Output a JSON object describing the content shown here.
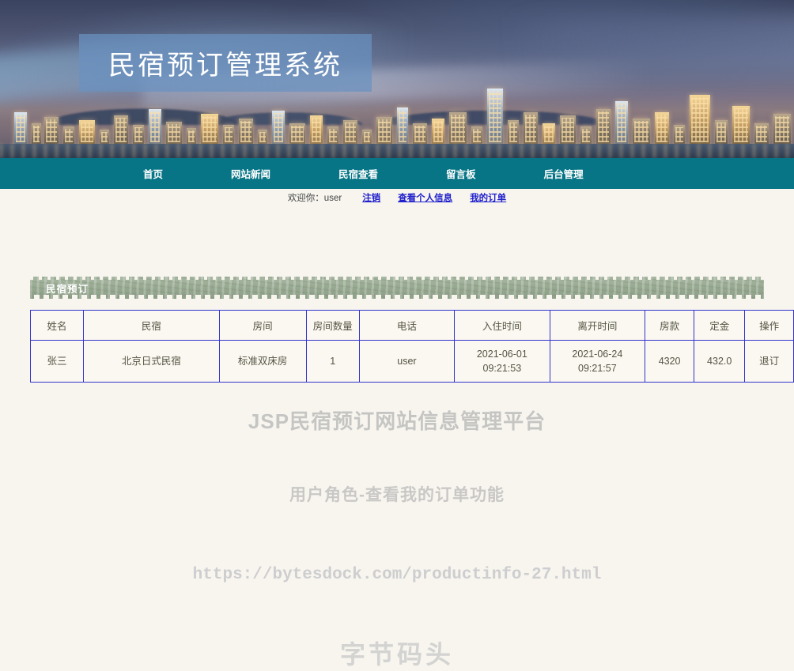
{
  "banner": {
    "title": "民宿预订管理系统",
    "image_alt": "city-night-skyline"
  },
  "nav": {
    "items": [
      {
        "label": "首页",
        "name": "nav-home"
      },
      {
        "label": "网站新闻",
        "name": "nav-news"
      },
      {
        "label": "民宿查看",
        "name": "nav-homestay"
      },
      {
        "label": "留言板",
        "name": "nav-message-board"
      },
      {
        "label": "后台管理",
        "name": "nav-admin"
      }
    ]
  },
  "userbar": {
    "welcome": "欢迎你：user",
    "logout": "注销",
    "profile": "查看个人信息",
    "orders": "我的订单"
  },
  "section": {
    "title": "民宿预订"
  },
  "table": {
    "headers": [
      "姓名",
      "民宿",
      "房间",
      "房间数量",
      "电话",
      "入住时间",
      "离开时间",
      "房款",
      "定金",
      "操作"
    ],
    "rows": [
      {
        "name": "张三",
        "homestay": "北京日式民宿",
        "room": "标准双床房",
        "room_count": "1",
        "phone": "user",
        "checkin_date": "2021-06-01",
        "checkin_time": "09:21:53",
        "checkout_date": "2021-06-24",
        "checkout_time": "09:21:57",
        "price": "4320",
        "deposit": "432.0",
        "action": "退订"
      }
    ]
  },
  "watermarks": {
    "platform": "JSP民宿预订网站信息管理平台",
    "feature": "用户角色-查看我的订单功能",
    "url": "https://bytesdock.com/productinfo-27.html",
    "brand": "字节码头"
  },
  "colors": {
    "nav_teal": "#077586",
    "page_bg": "#f7f5ee",
    "section_green": "#95a78f",
    "table_border": "#3333cc",
    "link_blue": "#2020cc",
    "banner_box": "#6a91c1"
  }
}
